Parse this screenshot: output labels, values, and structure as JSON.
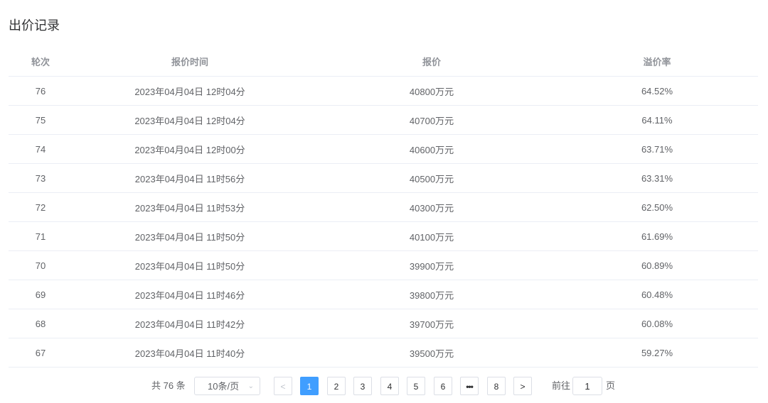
{
  "title": "出价记录",
  "table": {
    "headers": {
      "round": "轮次",
      "time": "报价时间",
      "price": "报价",
      "premium": "溢价率"
    },
    "rows": [
      {
        "round": "76",
        "time": "2023年04月04日 12时04分",
        "price": "40800万元",
        "premium": "64.52%"
      },
      {
        "round": "75",
        "time": "2023年04月04日 12时04分",
        "price": "40700万元",
        "premium": "64.11%"
      },
      {
        "round": "74",
        "time": "2023年04月04日 12时00分",
        "price": "40600万元",
        "premium": "63.71%"
      },
      {
        "round": "73",
        "time": "2023年04月04日 11时56分",
        "price": "40500万元",
        "premium": "63.31%"
      },
      {
        "round": "72",
        "time": "2023年04月04日 11时53分",
        "price": "40300万元",
        "premium": "62.50%"
      },
      {
        "round": "71",
        "time": "2023年04月04日 11时50分",
        "price": "40100万元",
        "premium": "61.69%"
      },
      {
        "round": "70",
        "time": "2023年04月04日 11时50分",
        "price": "39900万元",
        "premium": "60.89%"
      },
      {
        "round": "69",
        "time": "2023年04月04日 11时46分",
        "price": "39800万元",
        "premium": "60.48%"
      },
      {
        "round": "68",
        "time": "2023年04月04日 11时42分",
        "price": "39700万元",
        "premium": "60.08%"
      },
      {
        "round": "67",
        "time": "2023年04月04日 11时40分",
        "price": "39500万元",
        "premium": "59.27%"
      }
    ]
  },
  "pagination": {
    "total": "共 76 条",
    "page_size": "10条/页",
    "prev_icon": "chevron-left-icon",
    "next_icon": "chevron-right-icon",
    "pages": [
      "1",
      "2",
      "3",
      "4",
      "5",
      "6",
      "•••",
      "8"
    ],
    "current_page": "1",
    "goto_label": "前往",
    "goto_value": "1",
    "goto_unit": "页",
    "accent_color": "#409eff"
  }
}
